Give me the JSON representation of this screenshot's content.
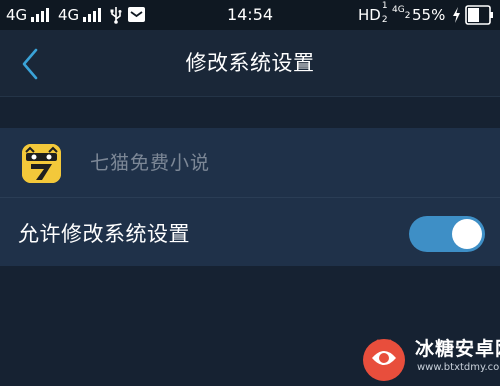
{
  "status_bar": {
    "sim1": "4G",
    "sim2": "4G",
    "time": "14:54",
    "hd": "HD",
    "hd_sub": "2",
    "hd_sup": "1",
    "net": "4G",
    "net_sub": "2",
    "battery": "55%"
  },
  "header": {
    "title": "修改系统设置"
  },
  "app": {
    "name": "七猫免费小说"
  },
  "permission": {
    "label": "允许修改系统设置",
    "enabled": true
  },
  "watermark": {
    "text": "冰糖安卓网",
    "url": "www.btxtdmy.com"
  },
  "colors": {
    "background": "#162232",
    "header": "#1a2738",
    "card": "#1f3149",
    "toggle_on": "#3e8fc6",
    "back_icon": "#3aa3d8",
    "app_icon": "#f3c83a"
  }
}
